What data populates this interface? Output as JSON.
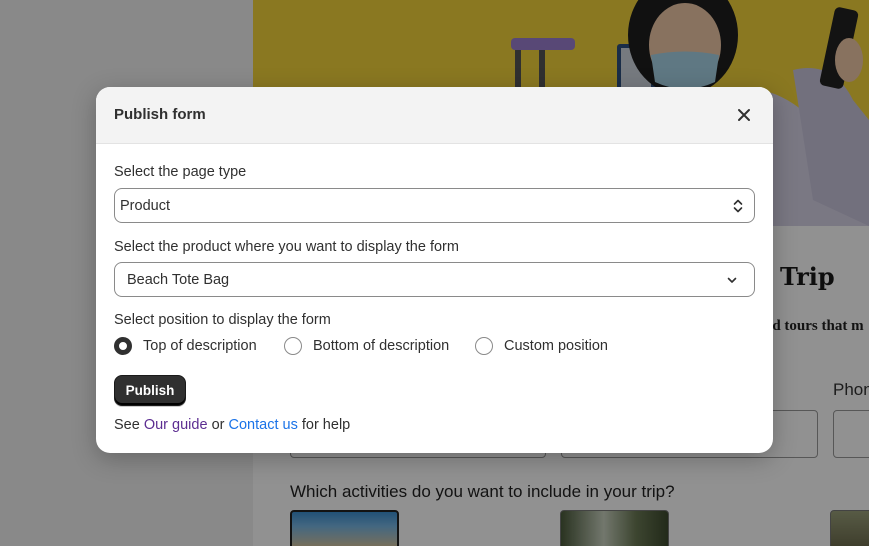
{
  "background": {
    "trip_title": "Trip",
    "trip_subtitle": "nd tours that m",
    "phone_label": "Phon",
    "activities_question": "Which activities do you want to include in your trip?"
  },
  "modal": {
    "title": "Publish form",
    "close_icon": "close-icon",
    "page_type": {
      "label": "Select the page type",
      "value": "Product",
      "icon": "select-arrows-icon"
    },
    "product": {
      "label": "Select the product where you want to display the form",
      "value": "Beach Tote Bag",
      "icon": "chevron-down-icon"
    },
    "position": {
      "label": "Select position to display the form",
      "options": [
        {
          "label": "Top of description",
          "checked": true
        },
        {
          "label": "Bottom of description",
          "checked": false
        },
        {
          "label": "Custom position",
          "checked": false
        }
      ]
    },
    "publish_label": "Publish",
    "help": {
      "prefix": "See",
      "guide_link": "Our guide",
      "middle": "or",
      "contact_link": "Contact us",
      "suffix": "for help"
    }
  },
  "colors": {
    "hero_yellow": "#f3d33a",
    "button_dark": "#303030",
    "link_purple": "#5c2d91",
    "link_blue": "#1a73e8"
  }
}
